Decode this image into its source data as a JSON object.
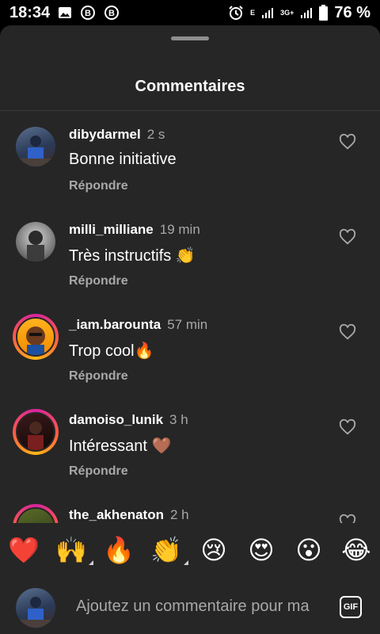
{
  "status_bar": {
    "time": "18:34",
    "network_label": "E",
    "network_label_2": "3G+",
    "battery": "76 %",
    "left_icons": [
      "image-icon",
      "b-circle-icon",
      "b-circle-icon"
    ]
  },
  "sheet": {
    "title": "Commentaires"
  },
  "comments": [
    {
      "username": "dibydarmel",
      "time": "2 s",
      "text": "Bonne initiative",
      "reply": "Répondre"
    },
    {
      "username": "milli_milliane",
      "time": "19 min",
      "text": "Très instructifs 👏",
      "reply": "Répondre"
    },
    {
      "username": "_iam.barounta",
      "time": "57 min",
      "text": "Trop cool🔥",
      "reply": "Répondre"
    },
    {
      "username": "damoiso_lunik",
      "time": "3 h",
      "text": "Intéressant 🤎",
      "reply": "Répondre"
    },
    {
      "username": "the_akhenaton",
      "time": "2 h",
      "text": "",
      "reply": ""
    }
  ],
  "emoji_bar": [
    "❤️",
    "🙌",
    "🔥",
    "👏",
    "😢",
    "😍",
    "😮",
    "😂"
  ],
  "composer": {
    "placeholder": "Ajoutez un commentaire pour ma",
    "gif_label": "GIF"
  },
  "colors": {
    "sheet_bg": "#262626",
    "secondary_text": "#a8a8a8",
    "story_ring": "#d6249f"
  }
}
